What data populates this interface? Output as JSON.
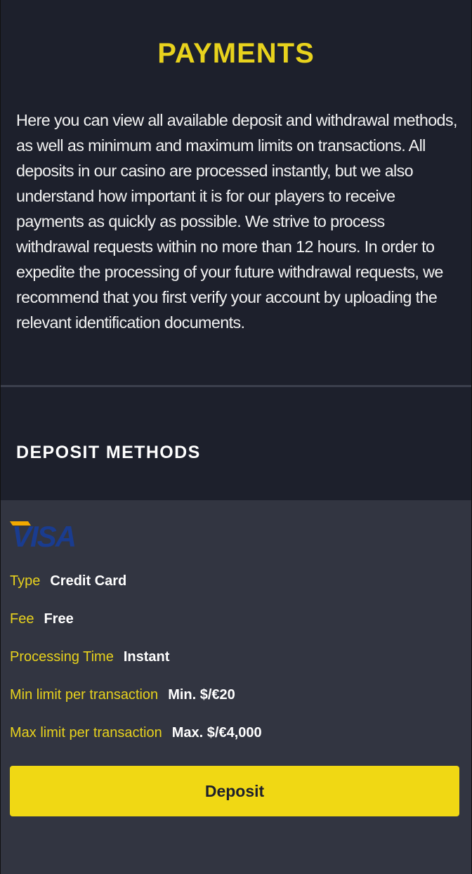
{
  "page": {
    "title": "PAYMENTS",
    "intro": "Here you can view all available deposit and withdrawal methods, as well as minimum and maximum limits on transactions. All deposits in our casino are processed instantly, but we also understand how important it is for our players to receive payments as quickly as possible. We strive to process withdrawal requests within no more than 12 hours. In order to expedite the processing of your future withdrawal requests, we recommend that you first verify your account by uploading the relevant identification documents."
  },
  "deposit_methods": {
    "section_title": "DEPOSIT METHODS",
    "methods": [
      {
        "logo": "VISA",
        "details": [
          {
            "label": "Type",
            "value": "Credit Card"
          },
          {
            "label": "Fee",
            "value": "Free"
          },
          {
            "label": "Processing Time",
            "value": "Instant"
          },
          {
            "label": "Min limit per transaction",
            "value": "Min. $/€20"
          },
          {
            "label": "Max limit per transaction",
            "value": "Max. $/€4,000"
          }
        ],
        "button_label": "Deposit"
      }
    ]
  },
  "colors": {
    "background": "#1d202c",
    "card": "#323541",
    "accent": "#e8d21d",
    "button": "#f0d814",
    "visa_blue": "#1a3c8f",
    "visa_gold": "#f2a900"
  }
}
